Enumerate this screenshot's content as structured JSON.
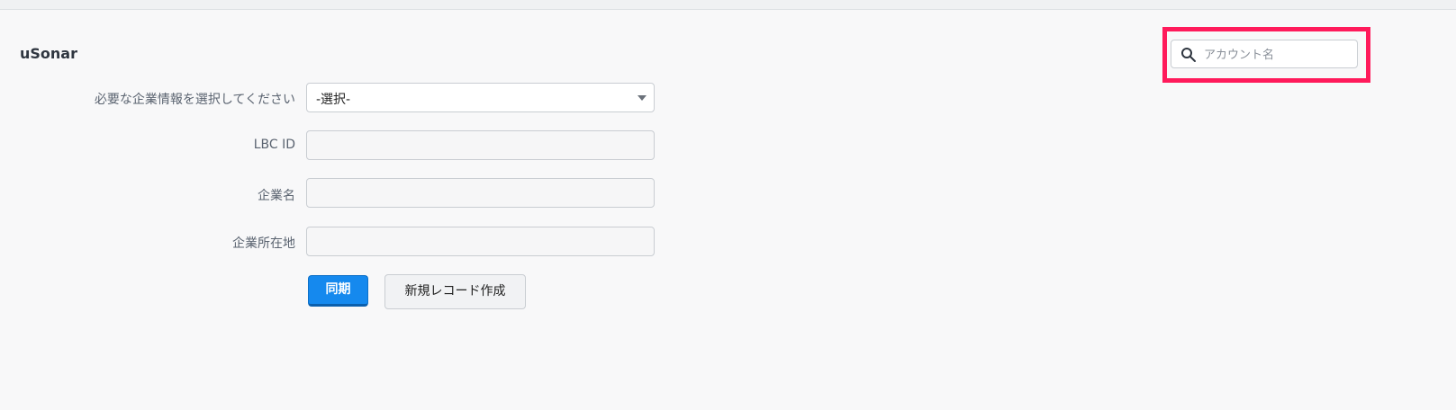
{
  "app": {
    "title": "uSonar"
  },
  "search": {
    "placeholder": "アカウント名",
    "highlight_color": "#ff1a5b"
  },
  "form": {
    "fields": [
      {
        "label": "必要な企業情報を選択してください",
        "type": "select",
        "value": "-選択-"
      },
      {
        "label": "LBC ID",
        "type": "text",
        "value": ""
      },
      {
        "label": "企業名",
        "type": "text",
        "value": ""
      },
      {
        "label": "企業所在地",
        "type": "text",
        "value": ""
      }
    ]
  },
  "buttons": {
    "sync_label": "同期",
    "new_record_label": "新規レコード作成"
  },
  "colors": {
    "primary": "#1589ee",
    "background": "#f8f8f9"
  }
}
